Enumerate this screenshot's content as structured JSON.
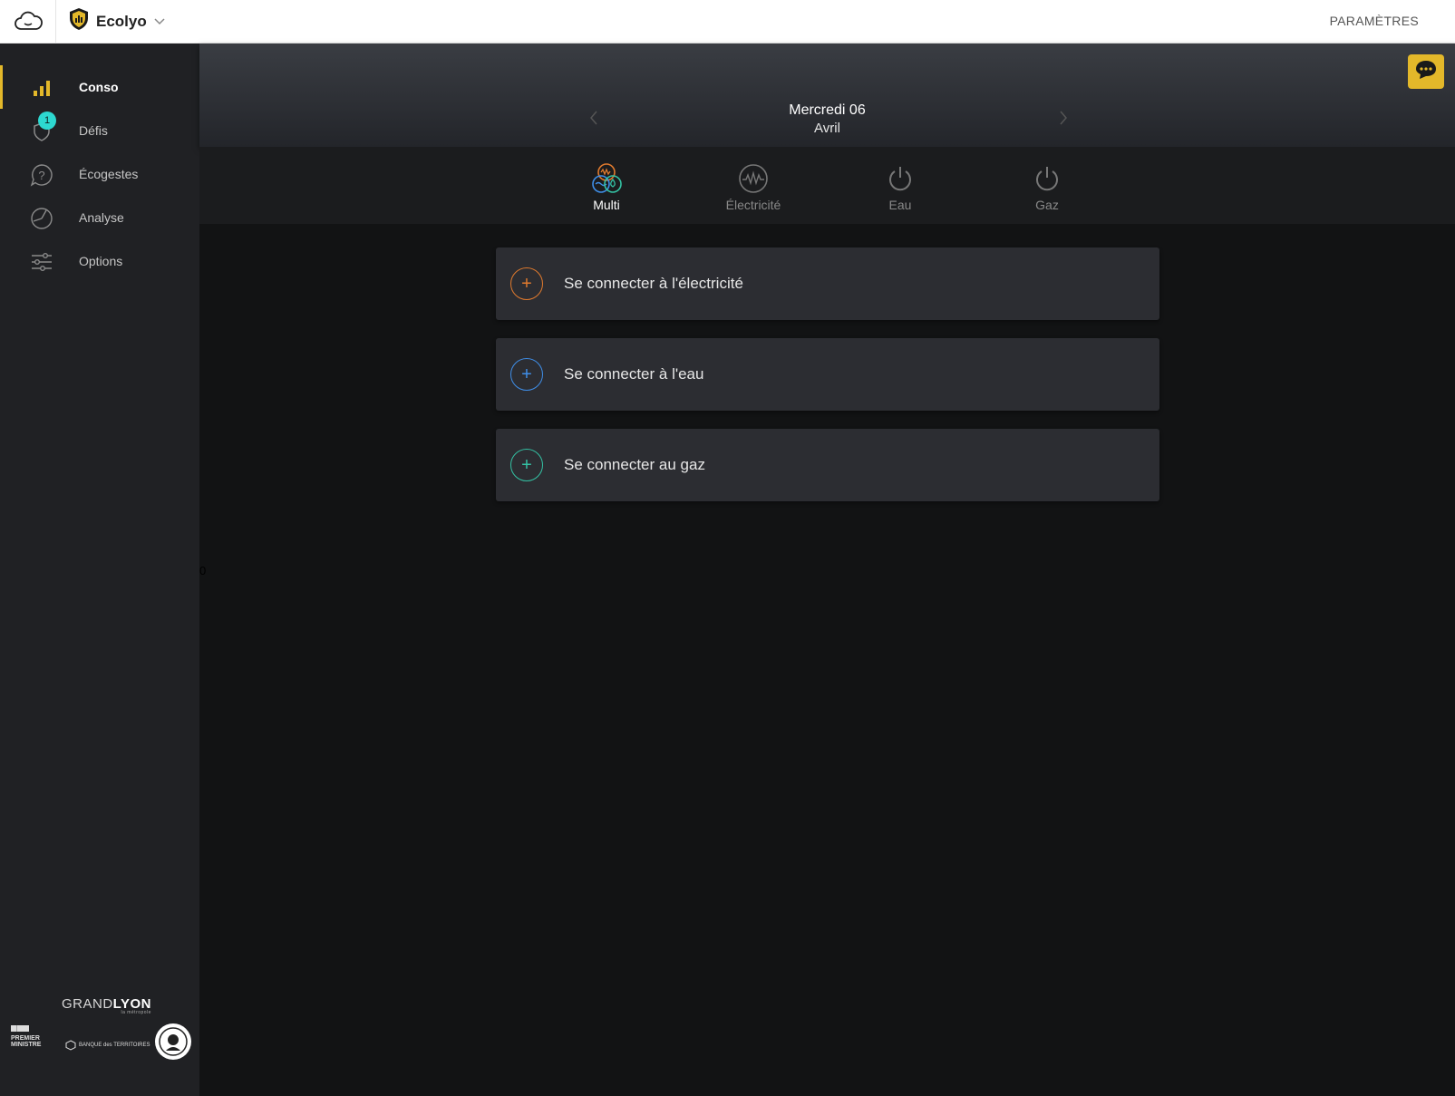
{
  "topbar": {
    "app_name": "Ecolyo",
    "settings_label": "PARAMÈTRES",
    "icons": [
      "cloud-icon",
      "ecolyo-shield-icon",
      "chevron-down-icon"
    ]
  },
  "sidebar": {
    "items": [
      {
        "label": "Conso",
        "icon": "bar-chart-icon",
        "active": true
      },
      {
        "label": "Défis",
        "icon": "challenge-icon",
        "badge": "1"
      },
      {
        "label": "Écogestes",
        "icon": "question-bubble-icon"
      },
      {
        "label": "Analyse",
        "icon": "analysis-pie-icon"
      },
      {
        "label": "Options",
        "icon": "sliders-icon"
      }
    ],
    "partners": {
      "grandlyon": "GRAND",
      "grandlyon_bold": "LYON",
      "grandlyon_sub": "la métropole",
      "premier_ministre": "PREMIER MINISTRE",
      "banque": "BANQUE des TERRITOIRES"
    }
  },
  "header": {
    "day": "Mercredi 06",
    "month": "Avril"
  },
  "tabs": [
    {
      "label": "Multi",
      "icon": "multi-fluid-icon",
      "active": true
    },
    {
      "label": "Électricité",
      "icon": "electricity-wave-icon"
    },
    {
      "label": "Eau",
      "icon": "power-icon"
    },
    {
      "label": "Gaz",
      "icon": "power-icon"
    }
  ],
  "cards": [
    {
      "label": "Se connecter à l'électricité",
      "color": "#e07a2e"
    },
    {
      "label": "Se connecter à l'eau",
      "color": "#3f8ee8"
    },
    {
      "label": "Se connecter au gaz",
      "color": "#34c2a4"
    }
  ],
  "stray_text": "0",
  "colors": {
    "accent": "#e3b82a",
    "badge": "#2dd8d0"
  }
}
